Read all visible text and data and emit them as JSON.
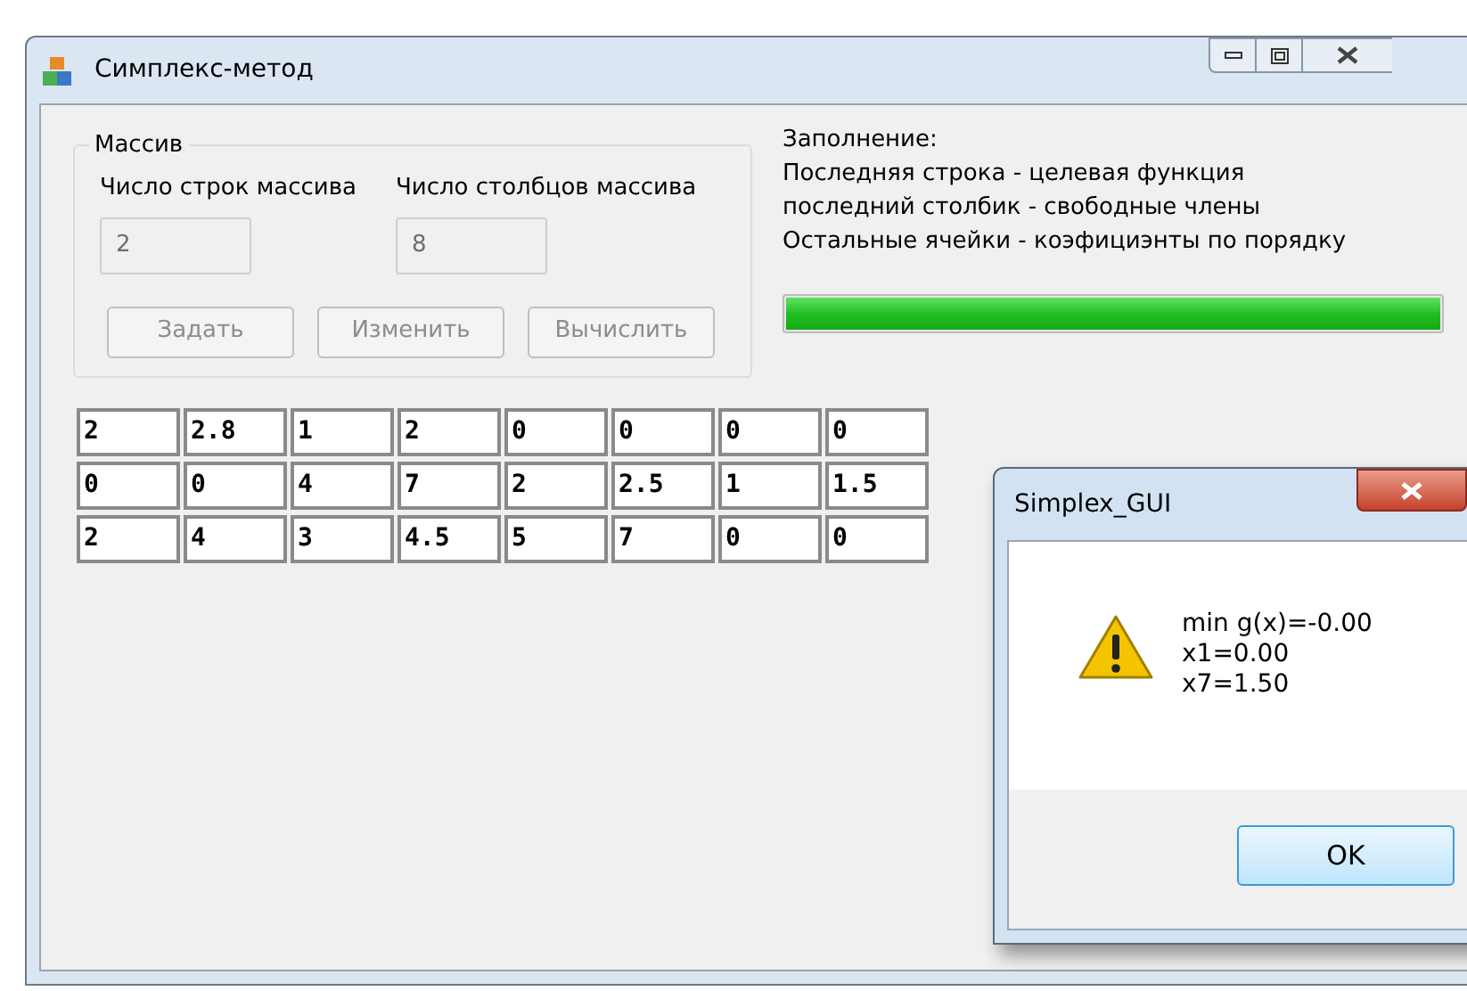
{
  "window": {
    "title": "Симплекс-метод"
  },
  "group": {
    "title": "Массив",
    "fields": [
      {
        "label": "Число строк массива",
        "value": "2",
        "disabled": true
      },
      {
        "label": "Число столбцов массива",
        "value": "8",
        "disabled": true
      }
    ],
    "buttons": [
      {
        "label": "Задать",
        "disabled": true
      },
      {
        "label": "Изменить",
        "disabled": true
      },
      {
        "label": "Вычислить",
        "disabled": true
      }
    ]
  },
  "info": [
    "Заполнение:",
    "Последняя строка - целевая функция",
    "последний столбик - свободные члены",
    "Остальные ячейки - коэфициэнты по порядку"
  ],
  "progress": {
    "level": 1
  },
  "grid": [
    [
      "2",
      "2.8",
      "1",
      "2",
      "0",
      "0",
      "0",
      "0"
    ],
    [
      "0",
      "0",
      "4",
      "7",
      "2",
      "2.5",
      "1",
      "1.5"
    ],
    [
      "2",
      "4",
      "3",
      "4.5",
      "5",
      "7",
      "0",
      "0"
    ]
  ],
  "dialog": {
    "title": "Simplex_GUI",
    "message": [
      "min g(x)=-0.00",
      "x1=0.00",
      "x7=1.50"
    ],
    "button": "OK"
  }
}
